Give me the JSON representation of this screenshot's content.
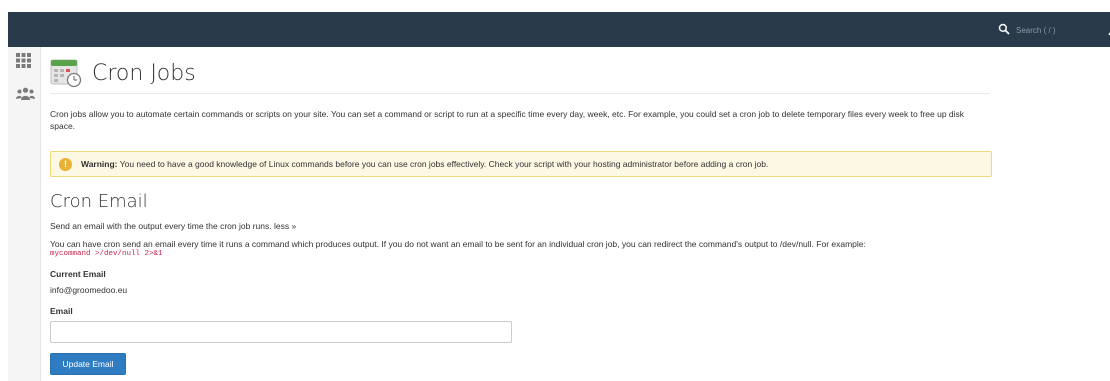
{
  "header": {
    "search_placeholder": "Search ( / )"
  },
  "sidebar": {
    "items": [
      {
        "icon": "grid-icon"
      },
      {
        "icon": "users-icon"
      }
    ]
  },
  "page": {
    "title": "Cron Jobs",
    "description": "Cron jobs allow you to automate certain commands or scripts on your site. You can set a command or script to run at a specific time every day, week, etc. For example, you could set a cron job to delete temporary files every week to free up disk space."
  },
  "warning": {
    "label": "Warning:",
    "text": " You need to have a good knowledge of Linux commands before you can use cron jobs effectively. Check your script with your hosting administrator before adding a cron job."
  },
  "cron_email": {
    "title": "Cron Email",
    "intro": "Send an email with the output every time the cron job runs.",
    "less_link": "less »",
    "detail": "You can have cron send an email every time it runs a command which produces output. If you do not want an email to be sent for an individual cron job, you can redirect the command's output to /dev/null. For example:",
    "example_code": "mycommand >/dev/null 2>&1",
    "current_email_label": "Current Email",
    "current_email_value": "info@groomedoo.eu",
    "email_label": "Email",
    "email_value": "",
    "update_button": "Update Email"
  },
  "colors": {
    "topbar": "#293a4a",
    "warning_bg": "#fcf8e3",
    "warning_icon": "#e9b236",
    "primary_button": "#2f7cc3",
    "code_text": "#c7254e"
  }
}
